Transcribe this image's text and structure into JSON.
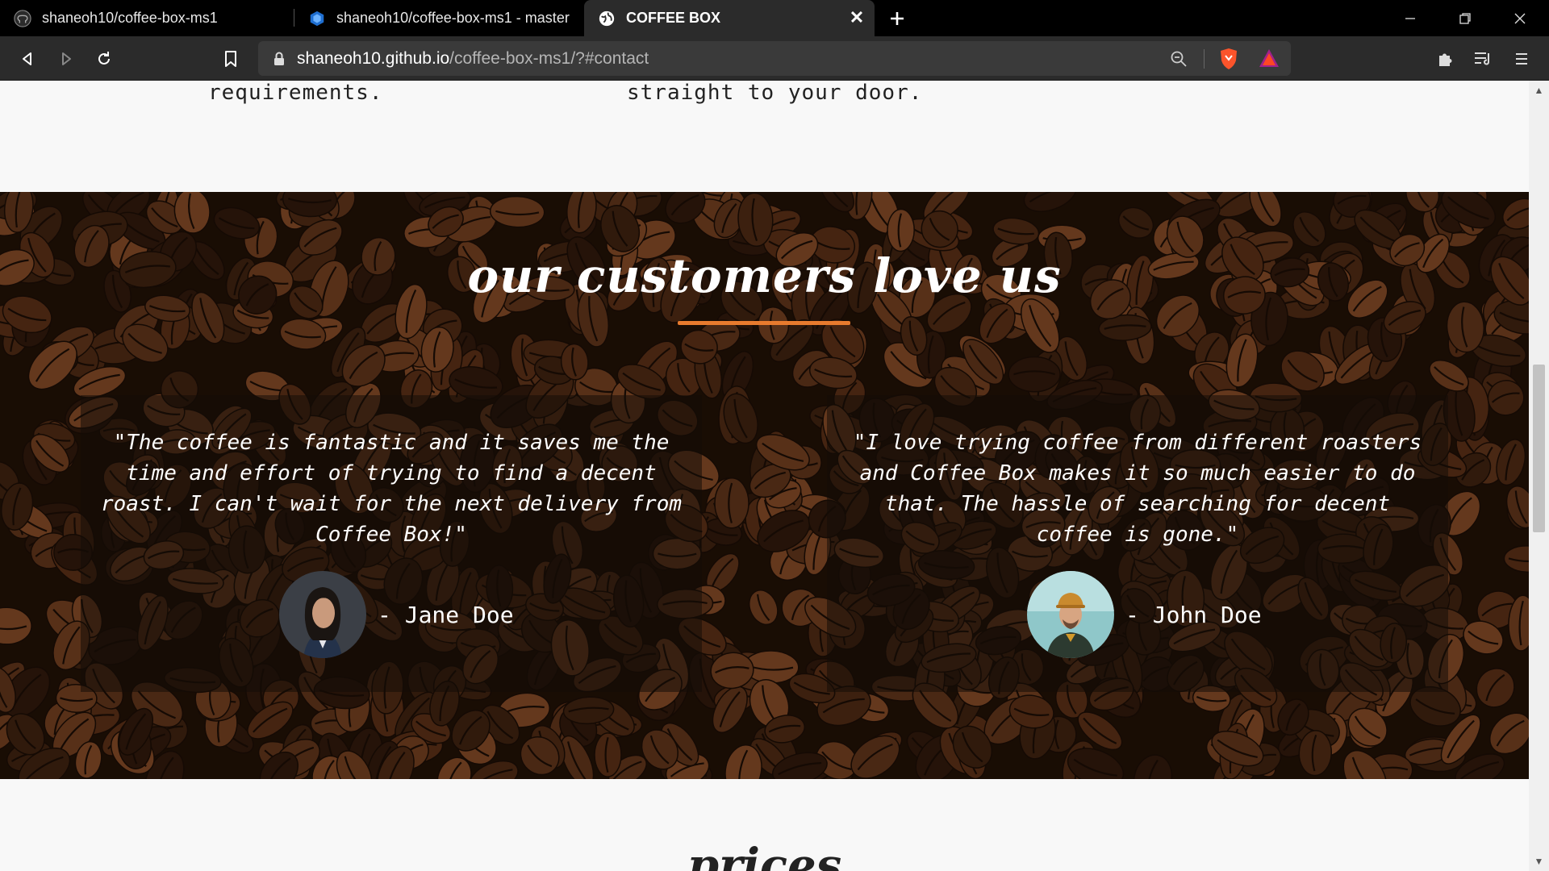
{
  "browser": {
    "tabs": [
      {
        "title": "shaneoh10/coffee-box-ms1",
        "icon": "github-icon",
        "active": false
      },
      {
        "title": "shaneoh10/coffee-box-ms1 - master",
        "icon": "hexagon-build-icon",
        "active": false
      },
      {
        "title": "COFFEE BOX",
        "icon": "globe-icon",
        "active": true
      }
    ],
    "url_host": "shaneoh10.github.io",
    "url_path": "/coffee-box-ms1/?#contact"
  },
  "page": {
    "top_left_text": "requirements.",
    "top_right_text": "straight to your door.",
    "testimonials_title": "our customers love us",
    "testimonials": [
      {
        "quote": "\"The coffee is fantastic and it saves me the time and effort of trying to find a decent roast. I can't wait for the next delivery from Coffee Box!\"",
        "author": "- Jane Doe"
      },
      {
        "quote": "\"I love trying coffee from different roasters and Coffee Box makes it so much easier to do that. The hassle of searching for decent coffee is gone.\"",
        "author": "- John Doe"
      }
    ],
    "next_section_title": "prices"
  },
  "colors": {
    "accent": "#e87b2e",
    "chrome_bg": "#000000",
    "toolbar_bg": "#2b2b2b"
  }
}
